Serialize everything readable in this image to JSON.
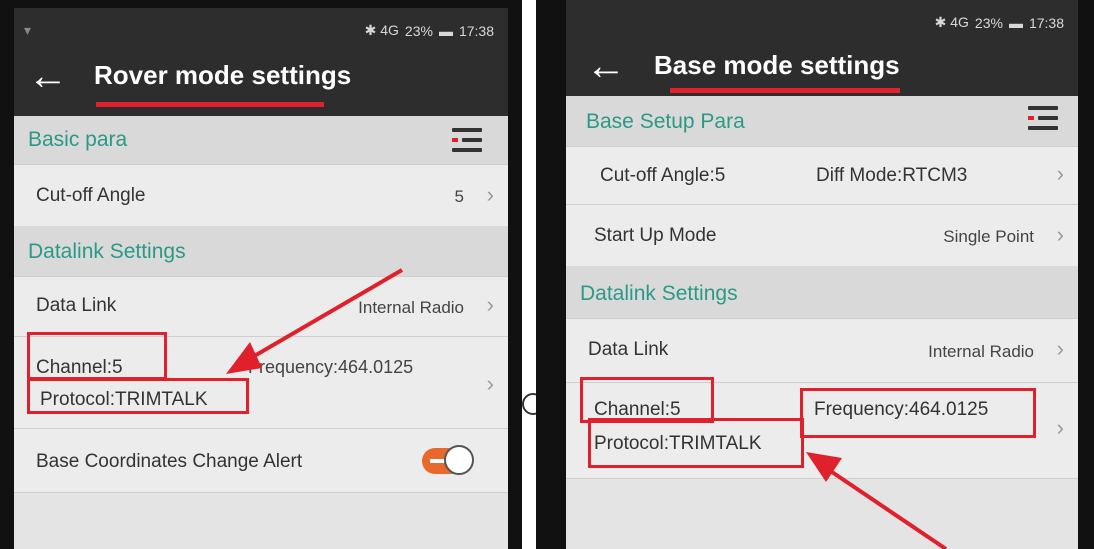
{
  "left": {
    "status": {
      "icons": "✱ 4G",
      "battery": "23%",
      "time": "17:38"
    },
    "title": "Rover mode settings",
    "section_basic": "Basic para",
    "cutoff_label": "Cut-off Angle",
    "cutoff_value": "5",
    "section_datalink": "Datalink Settings",
    "datalink_label": "Data Link",
    "datalink_value": "Internal Radio",
    "channel": "Channel:5",
    "frequency": "Frequency:464.0125",
    "protocol": "Protocol:TRIMTALK",
    "alert_label": "Base Coordinates Change Alert",
    "alert_on": true
  },
  "right": {
    "status": {
      "icons": "✱ 4G",
      "battery": "23%",
      "time": "17:38"
    },
    "title": "Base mode settings",
    "section_setup": "Base Setup Para",
    "cutoff": "Cut-off Angle:5",
    "diff_mode": "Diff Mode:RTCM3",
    "startup_label": "Start Up Mode",
    "startup_value": "Single Point",
    "section_datalink": "Datalink Settings",
    "datalink_label": "Data Link",
    "datalink_value": "Internal Radio",
    "channel": "Channel:5",
    "frequency": "Frequency:464.0125",
    "protocol": "Protocol:TRIMTALK"
  },
  "chevron": "›",
  "accent_color": "#e0202a",
  "section_color": "#2a9a86"
}
